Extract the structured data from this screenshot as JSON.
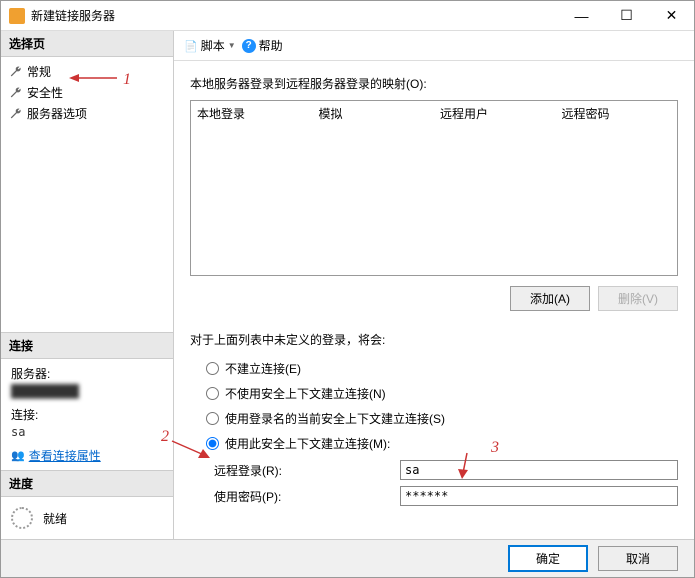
{
  "window": {
    "title": "新建链接服务器"
  },
  "sidebar": {
    "select_page": "选择页",
    "items": [
      {
        "label": "常规"
      },
      {
        "label": "安全性"
      },
      {
        "label": "服务器选项"
      }
    ],
    "connection": {
      "header": "连接",
      "server_label": "服务器:",
      "server_value": "████████",
      "conn_label": "连接:",
      "conn_value": "sa",
      "view_props": "查看连接属性"
    },
    "progress": {
      "header": "进度",
      "status": "就绪"
    }
  },
  "toolbar": {
    "script": "脚本",
    "help": "帮助"
  },
  "main": {
    "mapping_label": "本地服务器登录到远程服务器登录的映射(O):",
    "columns": {
      "local": "本地登录",
      "impersonate": "模拟",
      "remote_user": "远程用户",
      "remote_pwd": "远程密码"
    },
    "buttons": {
      "add": "添加(A)",
      "remove": "删除(V)"
    },
    "undefined_label": "对于上面列表中未定义的登录，将会:",
    "radios": {
      "r1": "不建立连接(E)",
      "r2": "不使用安全上下文建立连接(N)",
      "r3": "使用登录名的当前安全上下文建立连接(S)",
      "r4": "使用此安全上下文建立连接(M):"
    },
    "fields": {
      "remote_login_label": "远程登录(R):",
      "remote_login_value": "sa",
      "password_label": "使用密码(P):",
      "password_value": "******"
    }
  },
  "footer": {
    "ok": "确定",
    "cancel": "取消"
  },
  "annotations": {
    "a1": "1",
    "a2": "2",
    "a3": "3"
  }
}
